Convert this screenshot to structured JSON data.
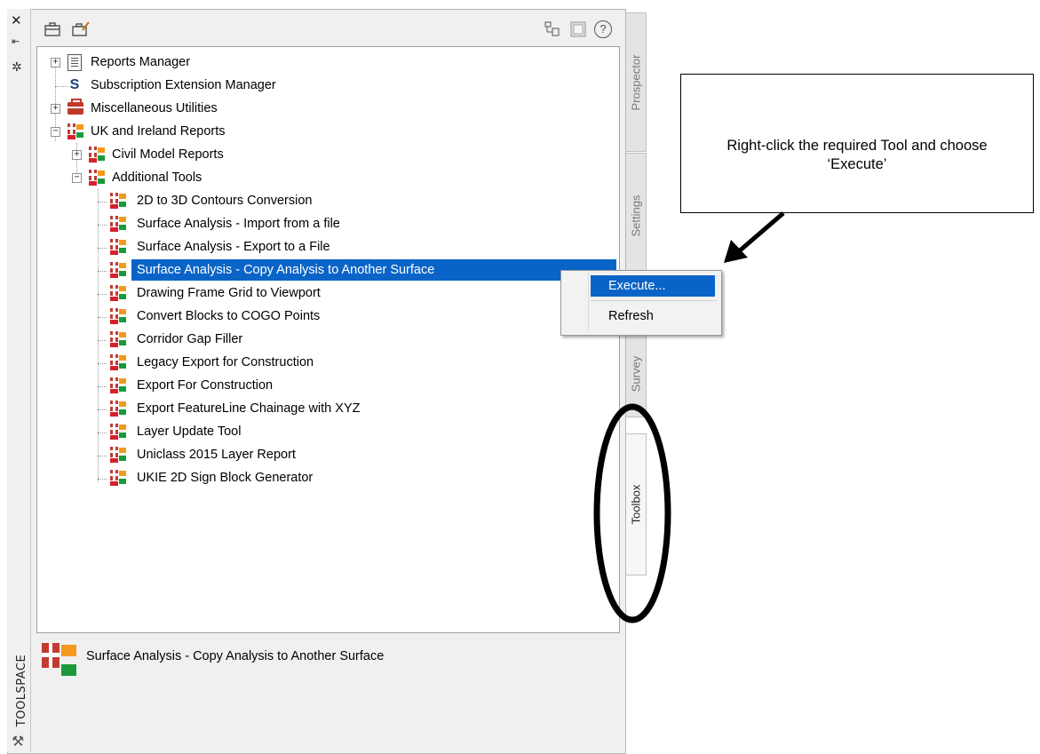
{
  "palette": {
    "title": "TOOLSPACE",
    "close_glyph": "✕",
    "autohide_glyph": "⇤",
    "properties_glyph": "✲"
  },
  "toolbar": {
    "icons": [
      "toolbox-icon",
      "edit-toolbox-icon",
      "tree-view-icon",
      "details-icon",
      "help-icon"
    ],
    "help_label": "?"
  },
  "tree": {
    "items": [
      {
        "label": "Reports Manager",
        "icon": "reports-icon",
        "expander": "+"
      },
      {
        "label": "Subscription Extension Manager",
        "icon": "s-icon"
      },
      {
        "label": "Miscellaneous Utilities",
        "icon": "toolbox-icon",
        "expander": "+"
      },
      {
        "label": "UK and Ireland Reports",
        "icon": "ukie-icon",
        "expander": "−"
      },
      {
        "label": "Civil Model Reports",
        "icon": "ukie-icon",
        "expander": "+"
      },
      {
        "label": "Additional Tools",
        "icon": "ukie-icon",
        "expander": "−"
      },
      {
        "label": "2D to 3D Contours Conversion",
        "icon": "ukie-icon"
      },
      {
        "label": "Surface Analysis - Import from a file",
        "icon": "ukie-icon"
      },
      {
        "label": "Surface Analysis - Export to a File",
        "icon": "ukie-icon"
      },
      {
        "label": "Surface Analysis - Copy Analysis to Another Surface",
        "icon": "ukie-icon",
        "selected": true
      },
      {
        "label": "Drawing Frame Grid to Viewport",
        "icon": "ukie-icon"
      },
      {
        "label": "Convert Blocks to COGO Points",
        "icon": "ukie-icon"
      },
      {
        "label": "Corridor Gap Filler",
        "icon": "ukie-icon"
      },
      {
        "label": "Legacy Export for Construction",
        "icon": "ukie-icon"
      },
      {
        "label": "Export For Construction",
        "icon": "ukie-icon"
      },
      {
        "label": "Export FeatureLine Chainage with XYZ",
        "icon": "ukie-icon"
      },
      {
        "label": "Layer Update Tool",
        "icon": "ukie-icon"
      },
      {
        "label": "Uniclass 2015 Layer Report",
        "icon": "ukie-icon"
      },
      {
        "label": "UKIE 2D Sign Block Generator",
        "icon": "ukie-icon"
      }
    ]
  },
  "tabs": [
    "Prospector",
    "Settings",
    "Survey",
    "Toolbox"
  ],
  "active_tab": "Toolbox",
  "context_menu": {
    "items": [
      "Execute...",
      "Refresh"
    ],
    "hovered": "Execute..."
  },
  "callout": {
    "text": "Right-click the required Tool and choose ‘Execute’"
  },
  "description": {
    "text": "Surface Analysis - Copy Analysis to Another Surface"
  },
  "colors": {
    "selection": "#0a64c8",
    "highlight_ellipse": "#000000"
  }
}
